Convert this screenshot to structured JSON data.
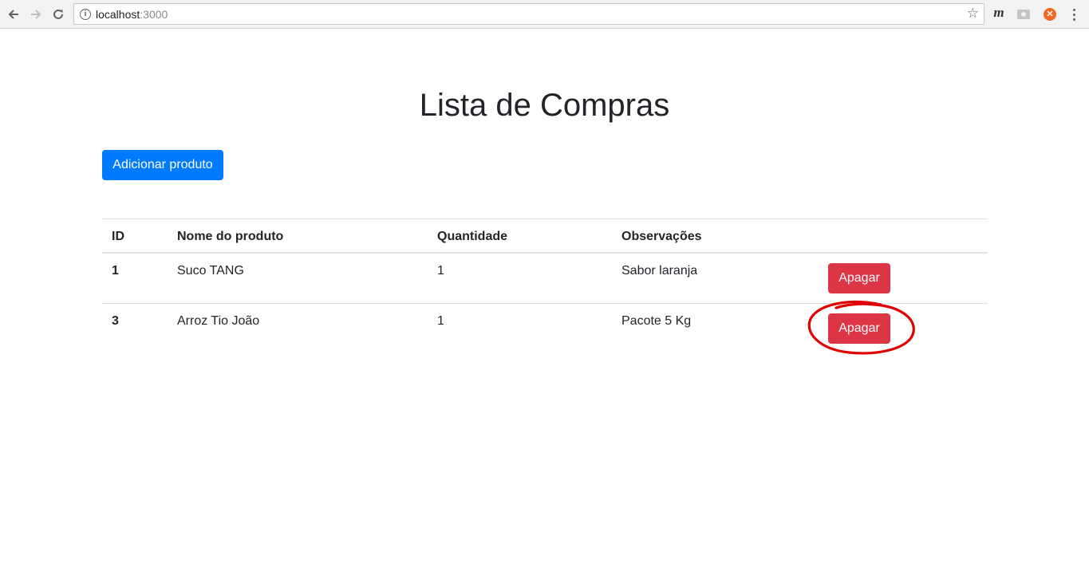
{
  "browser": {
    "url_host": "localhost",
    "url_port": ":3000"
  },
  "page": {
    "title": "Lista de Compras",
    "add_button_label": "Adicionar produto"
  },
  "table": {
    "headers": [
      "ID",
      "Nome do produto",
      "Quantidade",
      "Observações"
    ],
    "rows": [
      {
        "id": "1",
        "name": "Suco TANG",
        "quantity": "1",
        "notes": "Sabor laranja",
        "action": "Apagar"
      },
      {
        "id": "3",
        "name": "Arroz Tio João",
        "quantity": "1",
        "notes": "Pacote 5 Kg",
        "action": "Apagar"
      }
    ]
  },
  "colors": {
    "primary": "#007bff",
    "danger": "#dc3545",
    "annotation": "#e00000"
  },
  "icons": {
    "back": "arrow-left-icon",
    "forward": "arrow-right-icon",
    "reload": "reload-icon",
    "info": "info-icon",
    "bookmark": "star-icon",
    "menu": "kebab-menu-icon"
  }
}
